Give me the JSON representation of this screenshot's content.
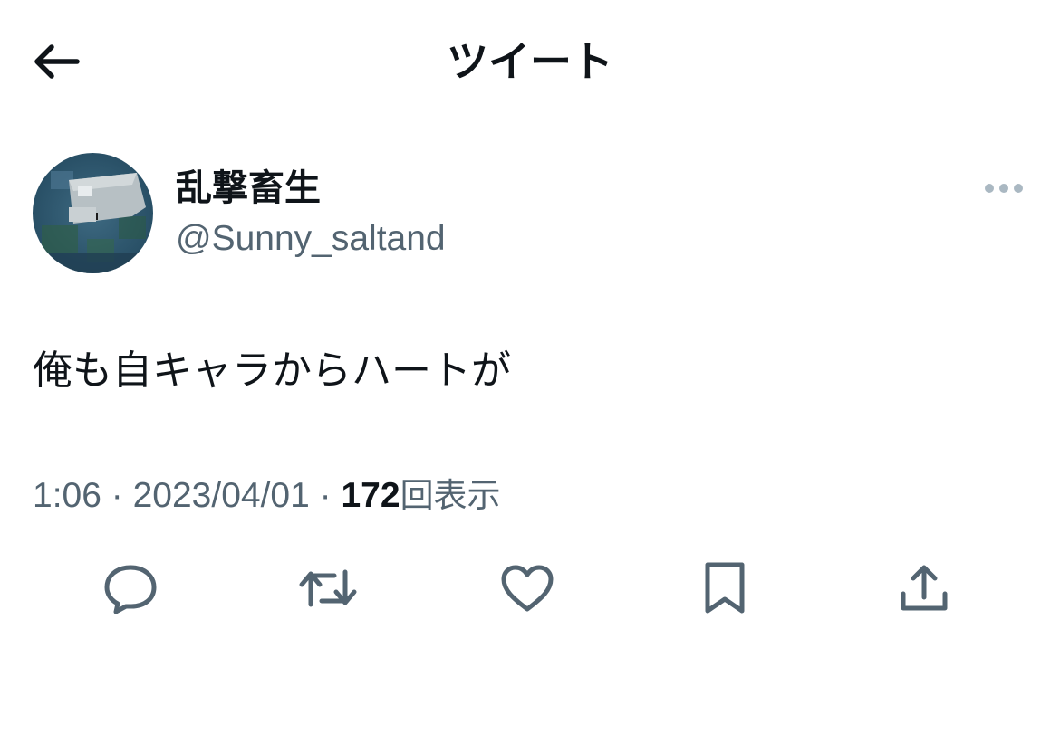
{
  "header": {
    "title": "ツイート",
    "back_icon": "arrow-left-icon"
  },
  "tweet": {
    "author": {
      "display_name": "乱撃畜生",
      "handle": "@Sunny_saltand"
    },
    "text": "俺も自キャラからハートが",
    "time": "1:06",
    "separator": "·",
    "date": "2023/04/01",
    "views_count": "172",
    "views_label": "回表示"
  },
  "actions": [
    {
      "name": "reply",
      "icon": "reply-icon"
    },
    {
      "name": "retweet",
      "icon": "retweet-icon"
    },
    {
      "name": "like",
      "icon": "heart-icon"
    },
    {
      "name": "bookmark",
      "icon": "bookmark-icon"
    },
    {
      "name": "share",
      "icon": "share-icon"
    }
  ],
  "colors": {
    "text_primary": "#0f1419",
    "text_secondary": "#536471",
    "icon_gray": "#536471",
    "more_dots": "#aab8c2"
  }
}
